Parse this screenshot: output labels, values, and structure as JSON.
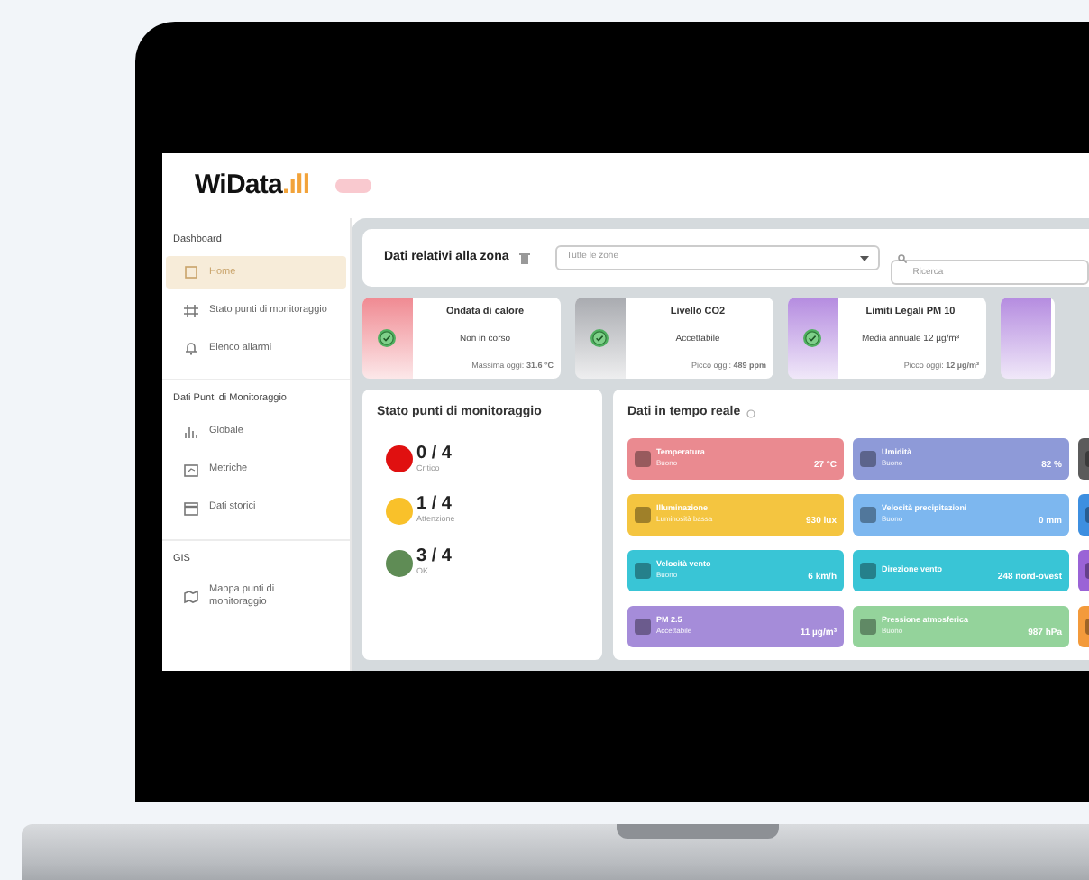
{
  "header": {
    "logo": "WiData",
    "logo_mark": ".ıll"
  },
  "sidebar": {
    "sections": [
      {
        "title": "Dashboard",
        "items": [
          {
            "label": "Home",
            "selected": true
          },
          {
            "label": "Stato punti di monitoraggio",
            "selected": false
          },
          {
            "label": "Elenco allarmi",
            "selected": false
          }
        ]
      },
      {
        "title": "Dati Punti di Monitoraggio",
        "items": [
          {
            "label": "Globale",
            "selected": false
          },
          {
            "label": "Metriche",
            "selected": false
          },
          {
            "label": "Dati storici",
            "selected": false
          }
        ]
      },
      {
        "title": "GIS",
        "items": [
          {
            "label": "Mappa punti di monitoraggio",
            "selected": false
          }
        ]
      }
    ]
  },
  "filter": {
    "title": "Dati relativi alla zona",
    "zone_select": "Tutte le zone",
    "search_placeholder": "Ricerca"
  },
  "cards": [
    {
      "kind": "full",
      "title": "Ondata di calore",
      "status": "Non in corso",
      "footer": "Massima oggi: **31.6 °C**",
      "color": "#f08a92"
    },
    {
      "kind": "full",
      "title": "Livello CO2",
      "status": "Accettabile",
      "footer": "Picco oggi: **489 ppm**",
      "color": "#a9abb0"
    },
    {
      "kind": "full",
      "title": "Limiti Legali PM 10",
      "status": "Media annuale 12 µg/m³",
      "footer": "Picco oggi: **12 µg/m³**",
      "color": "#b58ce0"
    },
    {
      "kind": "partial",
      "color": "#b58ce0"
    }
  ],
  "status_panel": {
    "title": "Stato punti di monitoraggio",
    "rows": [
      {
        "count": "0 / 4",
        "label": "Critico",
        "color": "#e01010"
      },
      {
        "count": "1 / 4",
        "label": "Attenzione",
        "color": "#f9c12a"
      },
      {
        "count": "3 / 4",
        "label": "OK",
        "color": "#5f8c55"
      }
    ]
  },
  "realtime": {
    "title": "Dati in tempo reale",
    "tiles": [
      {
        "label": "Temperatura",
        "status": "Buono",
        "value": "27 °C",
        "color": "#ea8a90"
      },
      {
        "label": "Umidità",
        "status": "Buono",
        "value": "82 %",
        "color": "#8e9ad8"
      },
      {
        "color": "#5b5b5b"
      },
      {
        "label": "Illuminazione",
        "status": "Luminosità bassa",
        "value": "930 lux",
        "color": "#f4c540"
      },
      {
        "label": "Velocità precipitazioni",
        "status": "Buono",
        "value": "0 mm",
        "color": "#7db7ef"
      },
      {
        "color": "#3d8fe0"
      },
      {
        "label": "Velocità vento",
        "status": "Buono",
        "value": "6 km/h",
        "color": "#39c5d6"
      },
      {
        "label": "Direzione vento",
        "value": "248 nord-ovest",
        "color": "#39c5d6"
      },
      {
        "color": "#9a63d6"
      },
      {
        "label": "PM 2.5",
        "status": "Accettabile",
        "value": "11 µg/m³",
        "color": "#a58cd9"
      },
      {
        "label": "Pressione atmosferica",
        "status": "Buono",
        "value": "987 hPa",
        "color": "#94d39b"
      },
      {
        "color": "#f39a3b"
      }
    ]
  }
}
